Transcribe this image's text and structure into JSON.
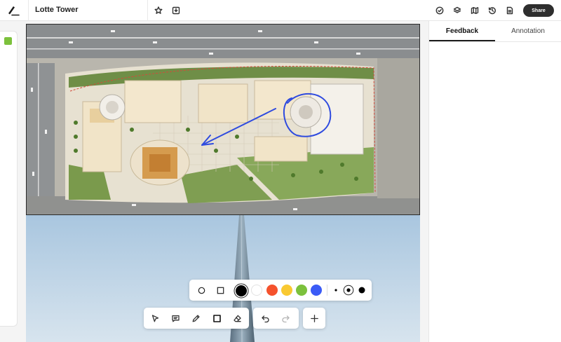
{
  "app": {
    "logo_icon": "pen-signature-icon"
  },
  "document": {
    "title": "Lotte Tower"
  },
  "header": {
    "actions": [
      "star-icon",
      "import-icon"
    ],
    "tools": [
      "check-circle-icon",
      "layers-icon",
      "map-icon",
      "history-icon",
      "document-icon"
    ],
    "share_label": "Share"
  },
  "rail": {
    "active_color": "#7cc13c"
  },
  "panel": {
    "tabs": [
      {
        "label": "Feedback",
        "active": true
      },
      {
        "label": "Annotation",
        "active": false
      }
    ]
  },
  "palette": {
    "shapes": [
      "circle-shape-icon",
      "square-shape-icon"
    ],
    "colors": [
      "#000000",
      "#ffffff",
      "#f5522d",
      "#f9c932",
      "#7cc13c",
      "#3b5bf6"
    ],
    "selected_color": "#000000",
    "stroke_sizes": [
      "small",
      "medium",
      "large"
    ],
    "selected_stroke": "medium"
  },
  "toolbar": {
    "tools": [
      "select-icon",
      "comment-icon",
      "pen-icon",
      "rectangle-icon",
      "eraser-icon"
    ],
    "active_tool": "rectangle-icon",
    "history": [
      "undo-icon",
      "redo-icon"
    ],
    "add": "plus-icon"
  },
  "annotation": {
    "stroke_color": "#2f4bdf"
  }
}
